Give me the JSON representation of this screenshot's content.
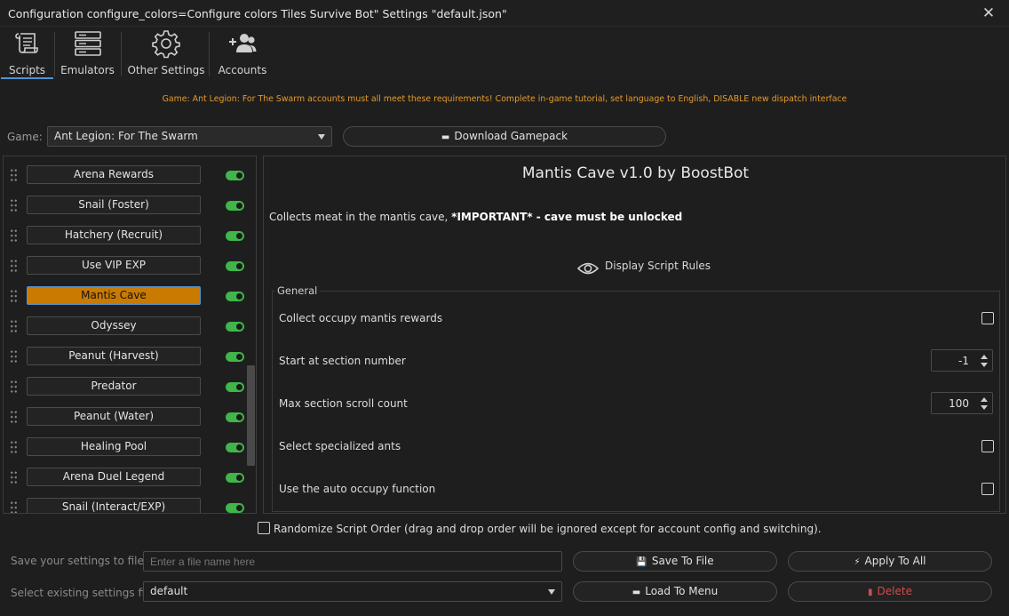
{
  "window": {
    "title": "Configuration configure_colors=Configure colors Tiles Survive Bot\" Settings \"default.json\"",
    "close_glyph": "✕"
  },
  "toolbar": {
    "tabs": [
      {
        "label": "Scripts",
        "icon": "scroll-icon",
        "active": true
      },
      {
        "label": "Emulators",
        "icon": "server-icon",
        "active": false
      },
      {
        "label": "Other Settings",
        "icon": "gear-icon",
        "active": false
      },
      {
        "label": "Accounts",
        "icon": "users-add-icon",
        "active": false
      }
    ]
  },
  "notice": "Game: Ant Legion: For The Swarm accounts must all meet these requirements! Complete in-game tutorial, set language to English, DISABLE new dispatch interface",
  "game": {
    "label": "Game:",
    "selected": "Ant Legion: For The Swarm",
    "download_label": "Download Gamepack",
    "download_icon": "▬"
  },
  "scripts": [
    {
      "name": "Arena Rewards",
      "enabled": true,
      "selected": false
    },
    {
      "name": "Snail (Foster)",
      "enabled": true,
      "selected": false
    },
    {
      "name": "Hatchery (Recruit)",
      "enabled": true,
      "selected": false
    },
    {
      "name": "Use VIP EXP",
      "enabled": true,
      "selected": false
    },
    {
      "name": "Mantis Cave",
      "enabled": true,
      "selected": true
    },
    {
      "name": "Odyssey",
      "enabled": true,
      "selected": false
    },
    {
      "name": "Peanut (Harvest)",
      "enabled": true,
      "selected": false
    },
    {
      "name": "Predator",
      "enabled": true,
      "selected": false
    },
    {
      "name": "Peanut (Water)",
      "enabled": true,
      "selected": false
    },
    {
      "name": "Healing Pool",
      "enabled": true,
      "selected": false
    },
    {
      "name": "Arena Duel Legend",
      "enabled": true,
      "selected": false
    },
    {
      "name": "Snail (Interact/EXP)",
      "enabled": true,
      "selected": false
    }
  ],
  "script_detail": {
    "title": "Mantis Cave v1.0 by BoostBot",
    "desc_plain": "Collects meat in the mantis cave, ",
    "desc_bold": "*IMPORTANT* - cave must be unlocked",
    "rules_label": "Display Script Rules",
    "group_title": "General",
    "options": [
      {
        "label": "Collect occupy mantis rewards",
        "type": "checkbox",
        "checked": false
      },
      {
        "label": "Start at section number",
        "type": "spinner",
        "value": "-1"
      },
      {
        "label": "Max section scroll count",
        "type": "spinner",
        "value": "100"
      },
      {
        "label": "Select specialized ants",
        "type": "checkbox",
        "checked": false
      },
      {
        "label": "Use the auto occupy function",
        "type": "checkbox",
        "checked": false
      }
    ]
  },
  "randomize": {
    "label": "Randomize Script Order (drag and drop order will be ignored except for account config and switching).",
    "checked": false
  },
  "footer": {
    "save_label": "Save your settings to file",
    "file_placeholder": "Enter a file name here",
    "save_button": "Save To File",
    "apply_button": "Apply To All",
    "select_label": "Select existing settings file",
    "selected_file": "default",
    "load_button": "Load To Menu",
    "delete_button": "Delete",
    "save_icon": "💾",
    "apply_icon": "⚡",
    "load_icon": "▬",
    "delete_icon": "▮"
  },
  "colors": {
    "accent": "#4f93d6",
    "selected_script": "#c97a00",
    "toggle_on": "#3fb54a",
    "notice": "#e49a2c",
    "delete": "#d44a4a"
  }
}
